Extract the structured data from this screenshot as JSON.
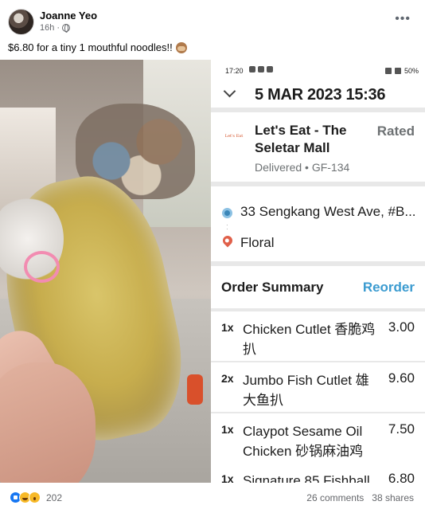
{
  "post": {
    "author": "Joanne Yeo",
    "time": "16h",
    "caption": "$6.80 for a tiny 1 mouthful noodles!!"
  },
  "phone": {
    "status_time": "17:20",
    "battery": "50%",
    "date": "5 MAR 2023 15:36",
    "restaurant": {
      "logo_text": "Let's Eat",
      "name": "Let's Eat - The Seletar Mall",
      "rated_label": "Rated",
      "status": "Delivered • GF-134"
    },
    "pickup_address": "33 Sengkang West Ave, #B...",
    "dropoff_address": "Floral",
    "summary_title": "Order Summary",
    "reorder_label": "Reorder",
    "items": [
      {
        "qty": "1x",
        "name": "Chicken Cutlet 香脆鸡扒",
        "price": "3.00"
      },
      {
        "qty": "2x",
        "name": "Jumbo Fish Cutlet 雄大鱼扒",
        "price": "9.60"
      },
      {
        "qty": "1x",
        "name": "Claypot Sesame Oil Chicken 砂锅麻油鸡",
        "price": "7.50"
      },
      {
        "qty": "1x",
        "name": "Signature 85 Fishball",
        "price": "6.80"
      }
    ]
  },
  "footer": {
    "reaction_count": "202",
    "comments": "26 comments",
    "shares": "38 shares"
  },
  "icons": [
    "globe-icon",
    "more-options-icon",
    "monkey-emoji-icon",
    "chevron-down-icon",
    "pickup-pin-icon",
    "dropoff-pin-icon",
    "like-reaction-icon",
    "haha-reaction-icon",
    "wow-reaction-icon"
  ],
  "colors": {
    "reorder": "#3b9bd0",
    "pickup_pin": "#3b86b8",
    "dropoff_pin": "#e0604a",
    "like": "#1877f2"
  }
}
